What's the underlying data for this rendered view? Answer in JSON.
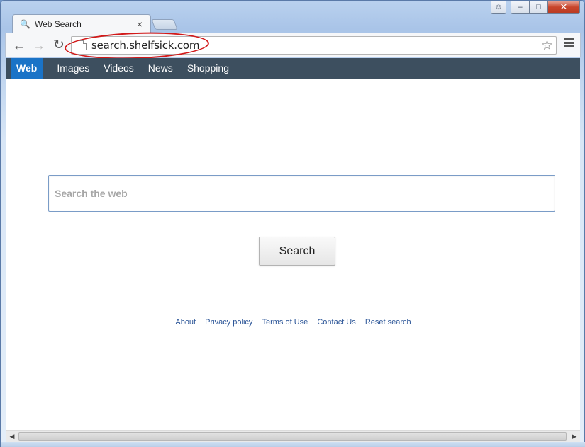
{
  "window": {
    "controls": {
      "user_icon": "user-icon",
      "minimize": "minimize-icon",
      "maximize": "maximize-icon",
      "close": "close-icon"
    }
  },
  "tab": {
    "title": "Web Search",
    "icon": "search-icon",
    "close_glyph": "×"
  },
  "toolbar": {
    "back_glyph": "←",
    "forward_glyph": "→",
    "reload_glyph": "↻",
    "url": "search.shelfsick.com",
    "star_glyph": "☆"
  },
  "search_nav": {
    "items": [
      {
        "label": "Web",
        "active": true
      },
      {
        "label": "Images",
        "active": false
      },
      {
        "label": "Videos",
        "active": false
      },
      {
        "label": "News",
        "active": false
      },
      {
        "label": "Shopping",
        "active": false
      }
    ]
  },
  "search": {
    "placeholder": "Search the web",
    "value": "",
    "button_label": "Search"
  },
  "footer": {
    "links": [
      "About",
      "Privacy policy",
      "Terms of Use",
      "Contact Us",
      "Reset search"
    ]
  },
  "colors": {
    "nav_bar": "#3d4f5f",
    "nav_active": "#1a73c7",
    "link": "#2a5497",
    "annotation": "#d21919"
  }
}
